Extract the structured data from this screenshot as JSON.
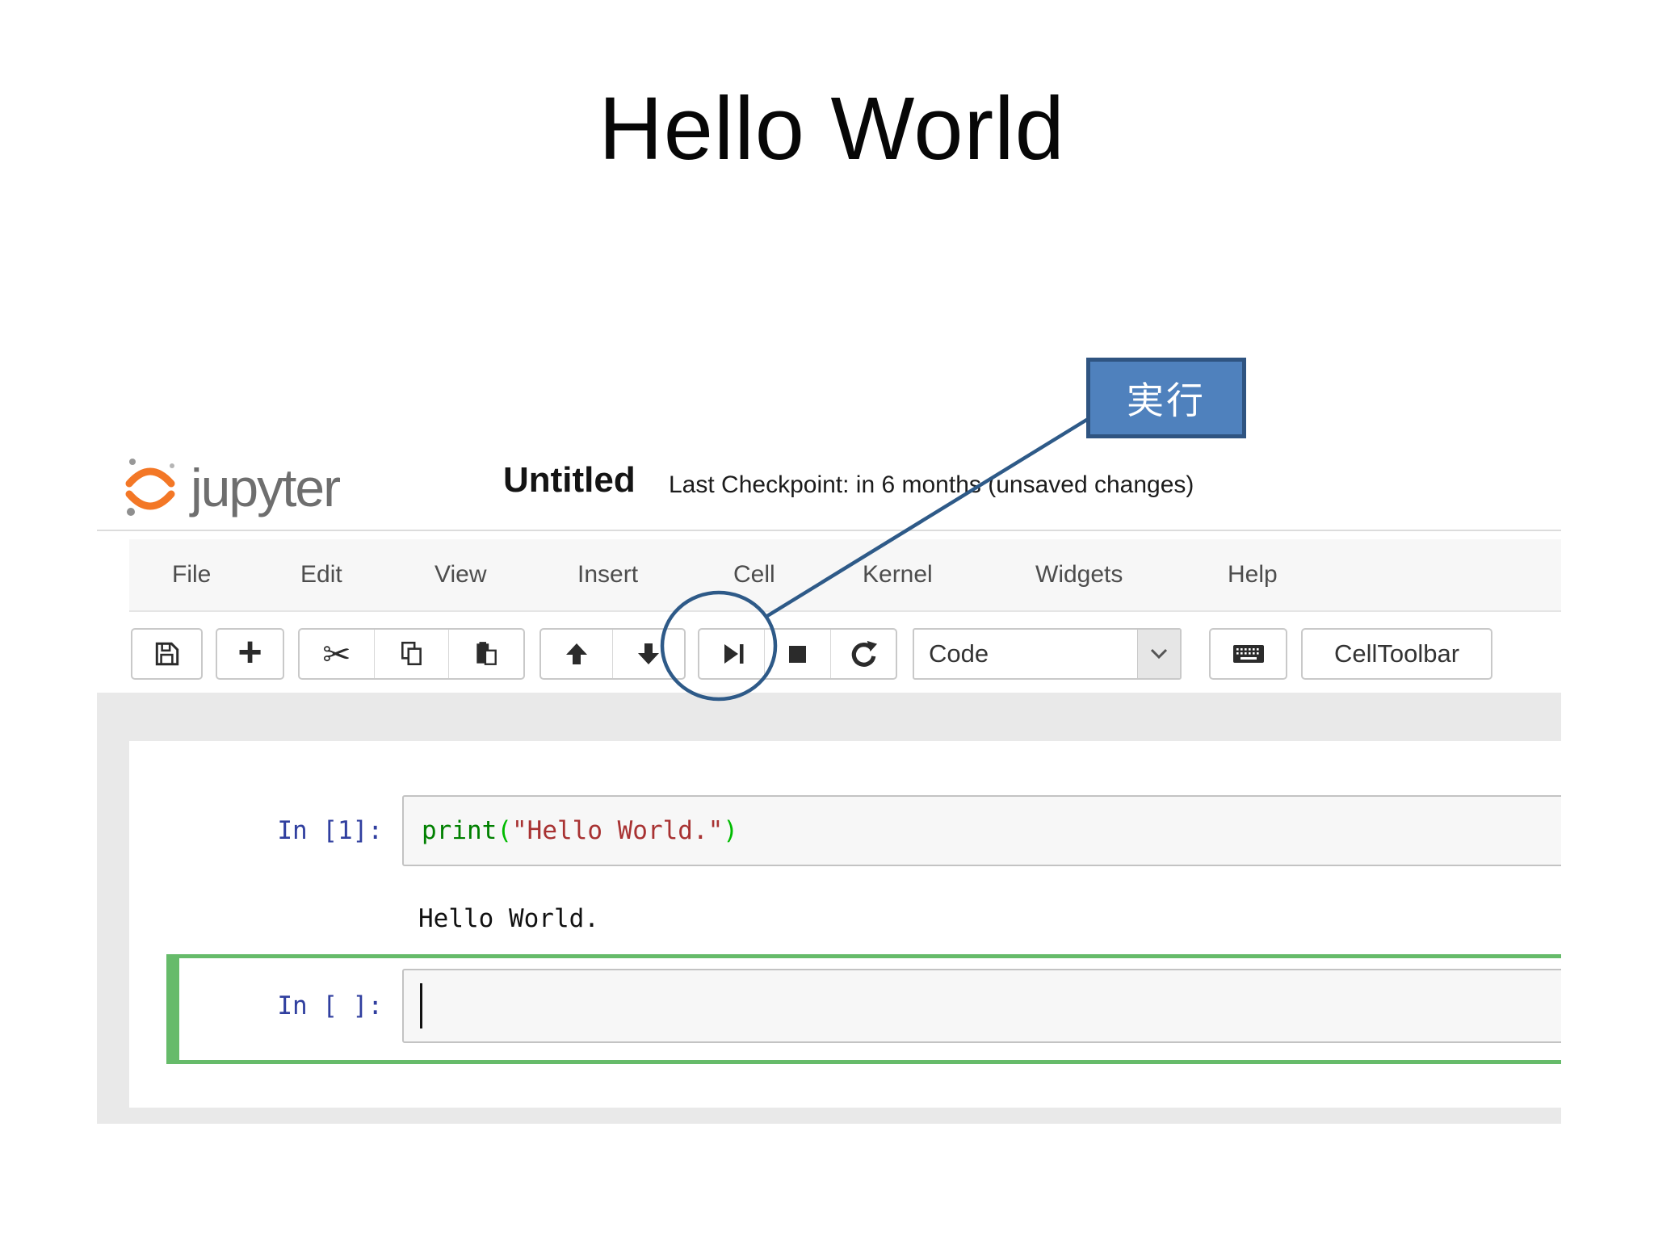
{
  "title": "Hello World",
  "callout": {
    "label": "実行"
  },
  "annotation": {
    "color": "#2e5a88",
    "shape": "circle-around-run-button-with-leader-line"
  },
  "notebook": {
    "logo_text": "jupyter",
    "filename": "Untitled",
    "checkpoint": "Last Checkpoint: in 6 months (unsaved changes)",
    "menu_items": [
      "File",
      "Edit",
      "View",
      "Insert",
      "Cell",
      "Kernel",
      "Widgets",
      "Help"
    ],
    "toolbar": {
      "button_icons": [
        "save-icon",
        "add-cell-icon",
        "cut-icon",
        "copy-icon",
        "paste-icon",
        "move-up-icon",
        "move-down-icon",
        "run-icon",
        "stop-icon",
        "restart-kernel-icon",
        "keyboard-icon"
      ],
      "glyphs": {
        "add": "+",
        "cut": "✂"
      },
      "cell_type": "Code",
      "celltoolbar_label": "CellToolbar"
    },
    "cells": [
      {
        "prompt": "In [1]:",
        "tokens": [
          {
            "text": "print",
            "color": "#008000"
          },
          {
            "text": "(",
            "color": "#00bb00"
          },
          {
            "text": "\"Hello World.\"",
            "color": "#a83232"
          },
          {
            "text": ")",
            "color": "#00bb00"
          }
        ],
        "output": "Hello World."
      },
      {
        "prompt": "In [ ]:",
        "code": ""
      }
    ]
  },
  "colors": {
    "jupyter_orange": "#f37726",
    "logo_gray": "#6e6e6e",
    "prompt_blue": "#303f9f",
    "selected_cell_green": "#66bb6a",
    "callout_fill": "#4f81bd",
    "callout_border": "#2f5481",
    "annotation_blue": "#2e5a88",
    "menubar_bg": "#f7f7f7",
    "notebook_band_bg": "#e9e9e9",
    "code_bg": "#f7f7f7"
  }
}
